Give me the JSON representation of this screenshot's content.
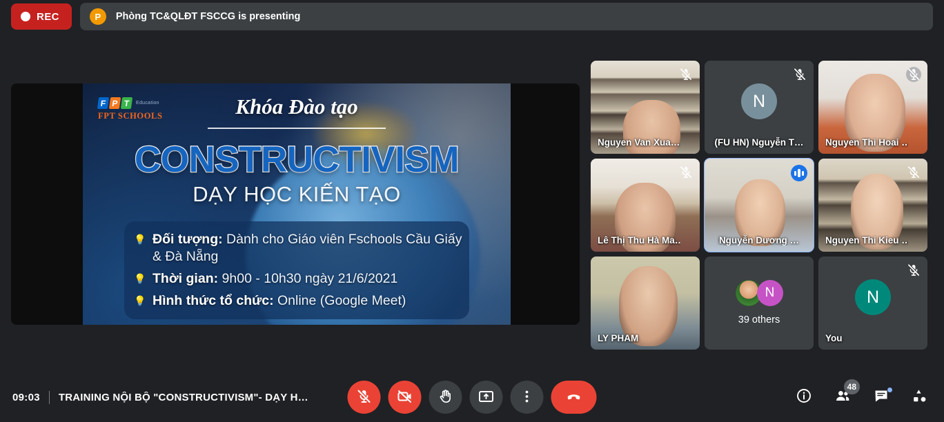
{
  "topbar": {
    "rec_label": "REC",
    "presenter_initial": "P",
    "presenting_text": "Phòng TC&QLĐT FSCCG is presenting"
  },
  "slide": {
    "logo_f": "F",
    "logo_p": "P",
    "logo_t": "T",
    "logo_education": "Education",
    "logo_schools": "FPT SCHOOLS",
    "kicker": "Khóa Đào tạo",
    "title": "CONSTRUCTIVISM",
    "subtitle": "DẠY HỌC KIẾN TẠO",
    "bullets": [
      {
        "label": "Đối tượng:",
        "value": "Dành cho Giáo viên Fschools Cầu Giấy & Đà Nẵng"
      },
      {
        "label": "Thời gian:",
        "value": "9h00 - 10h30 ngày 21/6/2021"
      },
      {
        "label": "Hình thức tổ chức:",
        "value": "Online (Google Meet)"
      }
    ]
  },
  "tiles": [
    {
      "name": "Nguyen Van Xua…",
      "muted": true,
      "mic_style": "plain",
      "kind": "video",
      "speaking": false
    },
    {
      "name": "(FU HN) Nguyễn T…",
      "muted": true,
      "mic_style": "circled",
      "kind": "avatar",
      "speaking": false,
      "avatar_letter": "N",
      "avatar_color": "#78909C",
      "name_align": "center"
    },
    {
      "name": "Nguyen Thi Hoai …",
      "muted": true,
      "mic_style": "light",
      "kind": "video",
      "speaking": false
    },
    {
      "name": "Lê Thị Thu Hà Ma…",
      "muted": true,
      "mic_style": "plain",
      "kind": "video",
      "speaking": false
    },
    {
      "name": "Nguyễn Dương …",
      "muted": false,
      "mic_style": "none",
      "kind": "video",
      "speaking": true,
      "name_align": "center"
    },
    {
      "name": "Nguyen Thi Kieu …",
      "muted": true,
      "mic_style": "plain",
      "kind": "video",
      "speaking": false
    },
    {
      "name": "LY PHAM",
      "muted": false,
      "mic_style": "none",
      "kind": "video",
      "speaking": false
    },
    {
      "name": "39 others",
      "muted": false,
      "mic_style": "none",
      "kind": "others",
      "speaking": false,
      "avatar_letter": "N",
      "avatar_color": "#C653C6"
    },
    {
      "name": "You",
      "muted": true,
      "mic_style": "circled",
      "kind": "avatar",
      "speaking": false,
      "avatar_letter": "N",
      "avatar_color": "#00897B"
    }
  ],
  "bottombar": {
    "time": "09:03",
    "meeting_title": "TRAINING NỘI BỘ \"CONSTRUCTIVISM\"- DẠY H…",
    "controls": [
      {
        "icon": "microphone-off-icon",
        "name": "toggle-microphone-button",
        "style": "danger"
      },
      {
        "icon": "camera-off-icon",
        "name": "toggle-camera-button",
        "style": "danger"
      },
      {
        "icon": "raise-hand-icon",
        "name": "raise-hand-button",
        "style": "normal"
      },
      {
        "icon": "present-screen-icon",
        "name": "present-now-button",
        "style": "normal"
      },
      {
        "icon": "more-options-icon",
        "name": "more-options-button",
        "style": "normal"
      },
      {
        "icon": "hangup-icon",
        "name": "leave-call-button",
        "style": "hangup"
      }
    ],
    "right_icons": [
      {
        "icon": "info-icon",
        "name": "meeting-details-button",
        "badge": ""
      },
      {
        "icon": "people-icon",
        "name": "show-everyone-button",
        "badge": "48"
      },
      {
        "icon": "chat-icon",
        "name": "chat-button",
        "badge": "",
        "dot": true
      },
      {
        "icon": "activities-icon",
        "name": "activities-button",
        "badge": ""
      }
    ]
  },
  "colors": {
    "accent_blue": "#8AB4F8",
    "danger_red": "#EA4335",
    "rec_red": "#C5221F",
    "presenter_orange": "#F29900",
    "surface": "#3c4043",
    "background": "#202124"
  }
}
